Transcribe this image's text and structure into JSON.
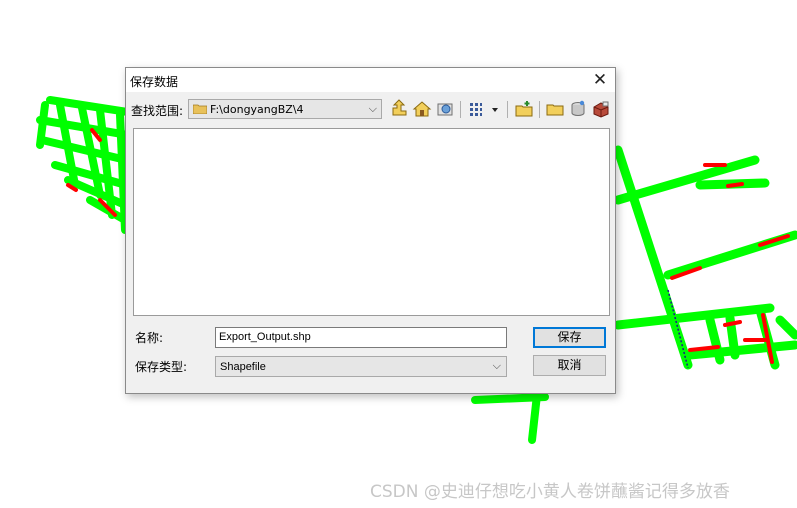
{
  "dialog": {
    "title": "保存数据",
    "close_symbol": "✕",
    "look_in_label": "查找范围:",
    "look_in_value": "F:\\dongyangBZ\\4",
    "name_label": "名称:",
    "name_value": "Export_Output.shp",
    "type_label": "保存类型:",
    "type_value": "Shapefile",
    "save_button": "保存",
    "cancel_button": "取消",
    "toolbar_icons": [
      "up-one-level-icon",
      "home-icon",
      "connect-folder-icon",
      "view-menu-icon",
      "new-folder-icon",
      "folder-icon",
      "database-icon",
      "toolbox-icon"
    ]
  },
  "map": {
    "road_color": "#00ff00",
    "highlight_color": "#ff0000"
  },
  "watermark": "CSDN @史迪仔想吃小黄人卷饼蘸酱记得多放香"
}
